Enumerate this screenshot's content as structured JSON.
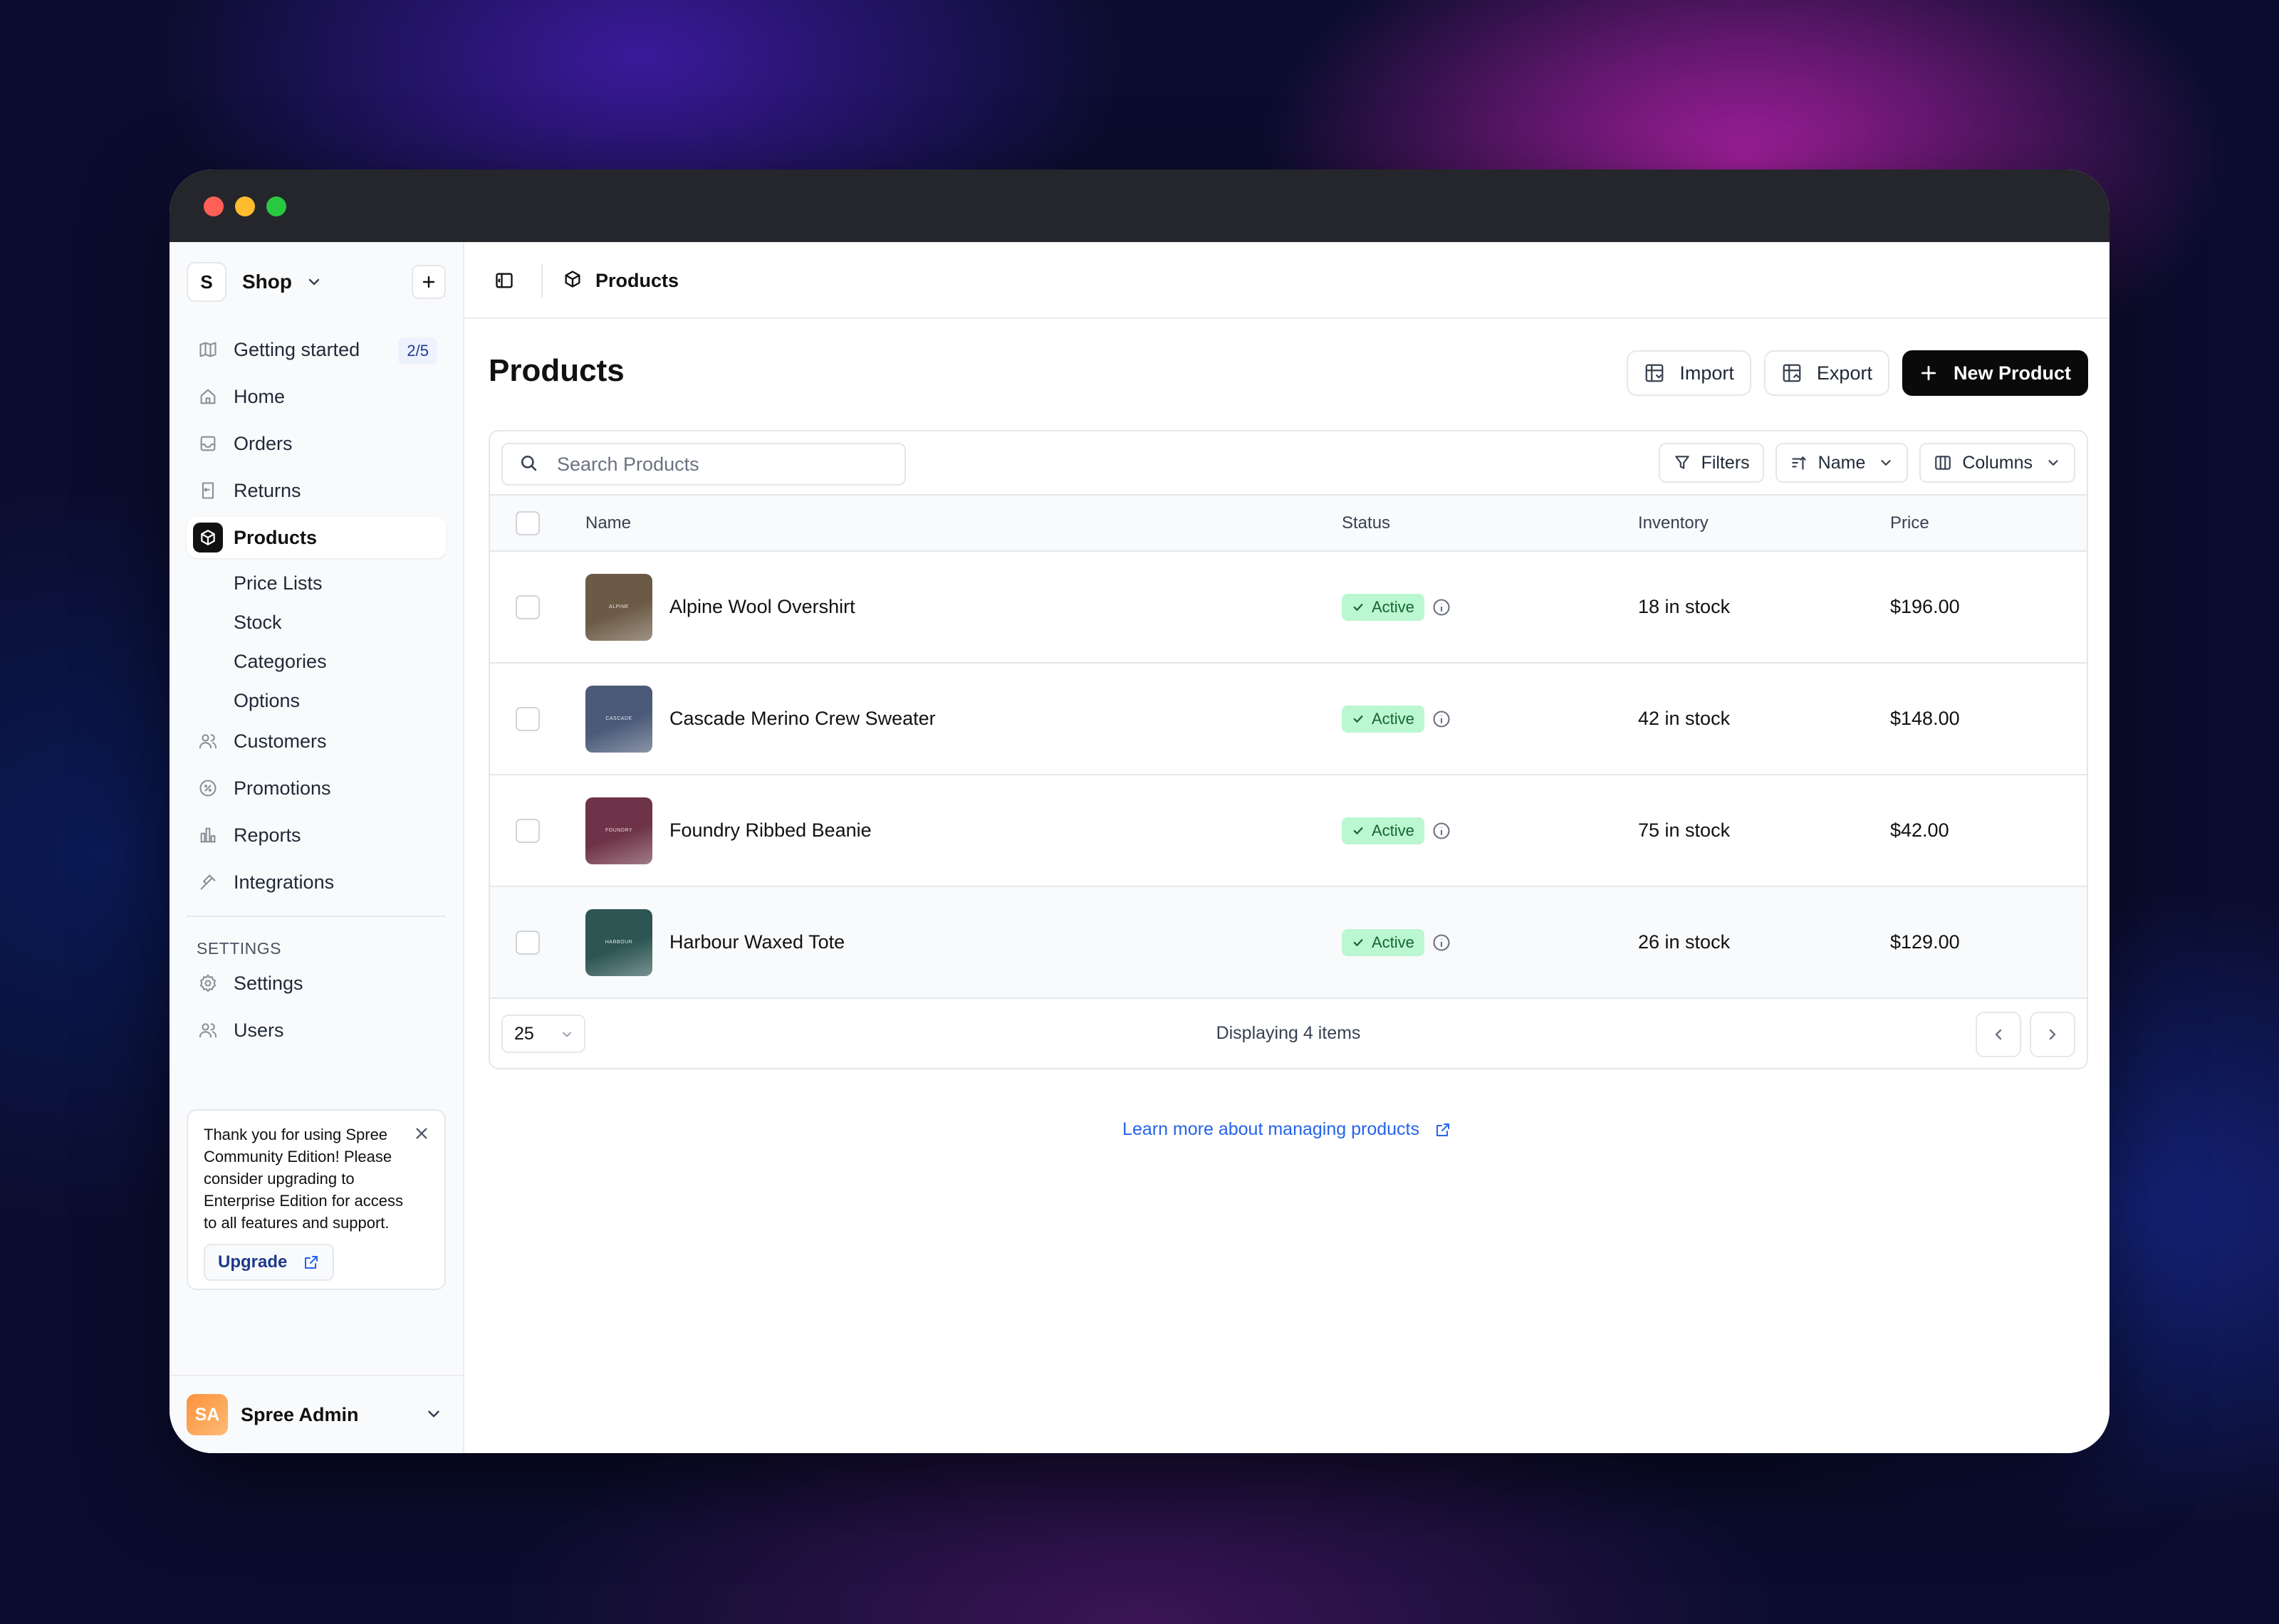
{
  "store": {
    "initial": "S",
    "name": "Shop"
  },
  "nav": {
    "getting_started": "Getting started",
    "getting_started_badge": "2/5",
    "home": "Home",
    "orders": "Orders",
    "returns": "Returns",
    "products": "Products",
    "sub": [
      "Price Lists",
      "Stock",
      "Categories",
      "Options"
    ],
    "customers": "Customers",
    "promotions": "Promotions",
    "reports": "Reports",
    "integrations": "Integrations"
  },
  "settings_section": {
    "title": "SETTINGS",
    "settings": "Settings",
    "users": "Users"
  },
  "promo": {
    "text": "Thank you for using Spree Community Edition! Please consider upgrading to Enterprise Edition for access to all features and support.",
    "upgrade": "Upgrade"
  },
  "user": {
    "initials": "SA",
    "name": "Spree Admin"
  },
  "breadcrumb": {
    "label": "Products"
  },
  "page": {
    "title": "Products",
    "import": "Import",
    "export": "Export",
    "new_product": "New Product"
  },
  "toolbar": {
    "search_placeholder": "Search Products",
    "filters": "Filters",
    "sort": "Name",
    "columns": "Columns"
  },
  "table": {
    "headers": [
      "Name",
      "Status",
      "Inventory",
      "Price"
    ],
    "rows": [
      {
        "name": "Alpine Wool Overshirt",
        "status": "Active",
        "inventory": "18 in stock",
        "price": "$196.00",
        "thumb_color": "#6b5a45"
      },
      {
        "name": "Cascade Merino Crew Sweater",
        "status": "Active",
        "inventory": "42 in stock",
        "price": "$148.00",
        "thumb_color": "#4a5a78"
      },
      {
        "name": "Foundry Ribbed Beanie",
        "status": "Active",
        "inventory": "75 in stock",
        "price": "$42.00",
        "thumb_color": "#6e3348"
      },
      {
        "name": "Harbour Waxed Tote",
        "status": "Active",
        "inventory": "26 in stock",
        "price": "$129.00",
        "thumb_color": "#2c5553"
      }
    ]
  },
  "footer": {
    "per_page": "25",
    "displaying": "Displaying 4 items"
  },
  "learn_more": "Learn more about managing products",
  "colors": {
    "accent_link": "#2563eb",
    "active_badge_bg": "#bbf7d0",
    "active_badge_text": "#166534",
    "primary_button": "#0a0a0a"
  }
}
